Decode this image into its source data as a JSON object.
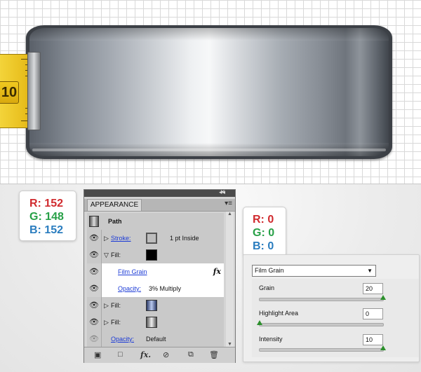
{
  "badges": {
    "left": {
      "r": "R: 152",
      "g": "G: 148",
      "b": "B: 152"
    },
    "right": {
      "r": "R: 0",
      "g": "G: 0",
      "b": "B: 0"
    }
  },
  "tape_number": "10",
  "panel": {
    "title": "APPEARANCE",
    "path_label": "Path",
    "stroke_label": "Stroke:",
    "stroke_value": "1 pt  Inside",
    "fill_label": "Fill:",
    "effect_label": "Film Grain",
    "fx_glyph": "fx",
    "opacity_label": "Opacity:",
    "opacity_value": "3% Multiply",
    "fill2_label": "Fill:",
    "fill3_label": "Fill:",
    "layer_opacity_label": "Opacity:",
    "layer_opacity_value": "Default"
  },
  "film_grain": {
    "filter": "Film Grain",
    "grain_label": "Grain",
    "grain_value": "20",
    "grain_level": 1.0,
    "highlight_label": "Highlight Area",
    "highlight_value": "0",
    "highlight_level": 0.0,
    "intensity_label": "Intensity",
    "intensity_value": "10",
    "intensity_level": 1.0
  }
}
